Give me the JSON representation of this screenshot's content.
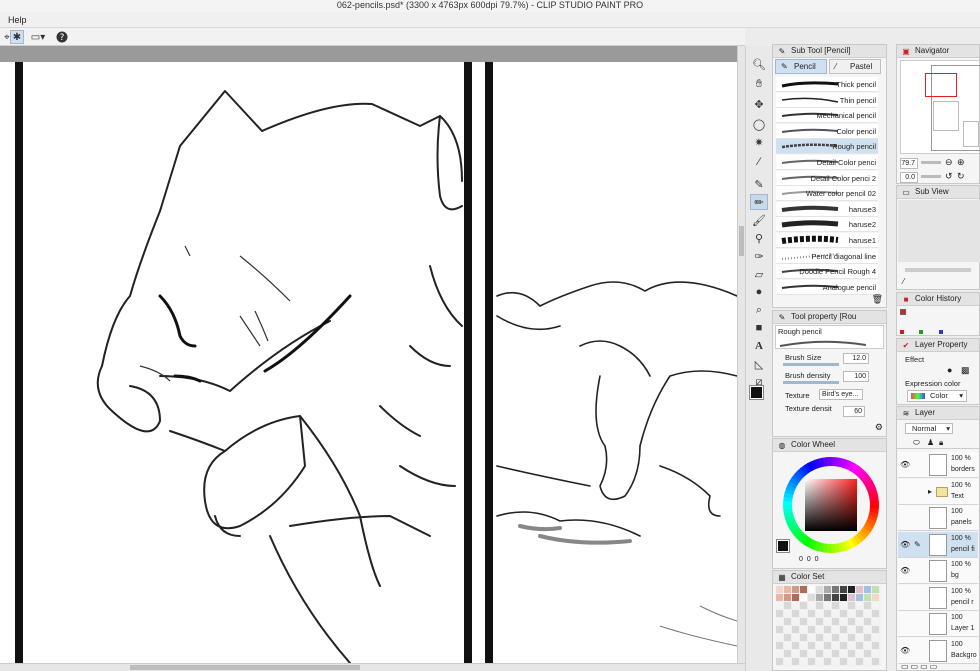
{
  "window": {
    "title": "062-pencils.psd* (3300 x 4763px 600dpi 79.7%)  - CLIP STUDIO PAINT PRO"
  },
  "menu": {
    "help": "Help"
  },
  "sub_tool": {
    "title": "Sub Tool [Pencil]",
    "tabs": [
      {
        "label": "Pencil"
      },
      {
        "label": "Pastel"
      }
    ],
    "brushes": [
      {
        "label": "Thick pencil"
      },
      {
        "label": "Thin pencil"
      },
      {
        "label": "Mechanical pencil"
      },
      {
        "label": "Color pencil"
      },
      {
        "label": "Rough pencil"
      },
      {
        "label": "Detail Color penci"
      },
      {
        "label": "Detail Color penci 2"
      },
      {
        "label": "Water color pencil 02"
      },
      {
        "label": "haruse3"
      },
      {
        "label": "haruse2"
      },
      {
        "label": "haruse1"
      },
      {
        "label": "Pencil diagonal line"
      },
      {
        "label": "Doodle Pencil Rough 4"
      },
      {
        "label": "Analogue pencil"
      }
    ]
  },
  "tool_property": {
    "title": "Tool property [Rou",
    "preview_name": "Rough pencil",
    "brush_size_label": "Brush Size",
    "brush_size_value": "12.0",
    "brush_density_label": "Brush density",
    "brush_density_value": "100",
    "texture_label": "Texture",
    "texture_value": "Bird's eye...",
    "texture_density_label": "Texture densit",
    "texture_density_value": "60"
  },
  "color_wheel": {
    "title": "Color Wheel",
    "readout": "0  0  0",
    "hue_colors": [
      "#ff0000",
      "#ffff00",
      "#00ff00",
      "#00ffff",
      "#0000ff",
      "#ff00ff",
      "#ff0000"
    ]
  },
  "color_set": {
    "title": "Color Set"
  },
  "navigator": {
    "title": "Navigator",
    "zoom_value": "79.7",
    "rotate_value": "0.0"
  },
  "sub_view": {
    "title": "Sub View"
  },
  "color_history": {
    "title": "Color History"
  },
  "layer_property": {
    "title": "Layer Property",
    "effect_label": "Effect",
    "expression_color_label": "Expression color",
    "expression_color_value": "Color"
  },
  "layer_panel": {
    "title": "Layer",
    "blend_mode": "Normal",
    "layers": [
      {
        "pct": "100 %",
        "name": "borders"
      },
      {
        "pct": "100 %",
        "name": "Text"
      },
      {
        "pct": "100",
        "name": "panels"
      },
      {
        "pct": "100 %",
        "name": "pencil fi"
      },
      {
        "pct": "100 %",
        "name": "bg"
      },
      {
        "pct": "100 %",
        "name": "pencil r"
      },
      {
        "pct": "100",
        "name": "Layer 1"
      },
      {
        "pct": "100",
        "name": "Backgro"
      }
    ]
  }
}
